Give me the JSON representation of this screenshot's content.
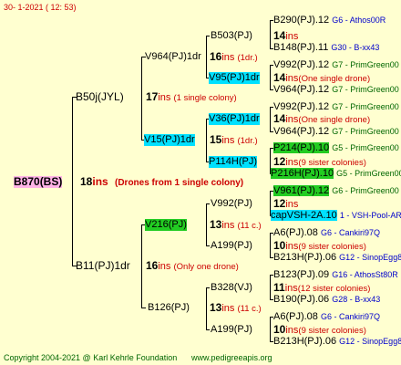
{
  "header": {
    "date": "30-   1-2021 (  12:  53)"
  },
  "root": {
    "name": "B870(BS)",
    "count": "18",
    "ins_label": "ins",
    "note": "(Drones from 1 single colony)"
  },
  "sire": {
    "name": "B50j(JYL)",
    "count": "17",
    "ins_label": "ins",
    "note": "(1 single colony)"
  },
  "dam": {
    "name": "B11(PJ)1dr",
    "count": "16",
    "ins_label": "ins",
    "note": "(Only one drone)"
  },
  "l2": [
    {
      "name": "V964(PJ)1dr",
      "count": "16",
      "ins_label": "ins",
      "note": "(1dr.)"
    },
    {
      "name": "V15(PJ)1dr",
      "count": "15",
      "ins_label": "ins",
      "note": "(1dr.)"
    },
    {
      "name": "V216(PJ)",
      "count": "13",
      "ins_label": "ins",
      "note": "(11 c.)"
    },
    {
      "name": "B126(PJ)",
      "count": "13",
      "ins_label": "ins",
      "note": "(11 c.)"
    }
  ],
  "l3": [
    {
      "name": "B503(PJ)",
      "count": "14",
      "ins_label": "ins",
      "note": ""
    },
    {
      "name": "V95(PJ)1dr",
      "count": "14",
      "ins_label": "ins",
      "note": "(One single drone)"
    },
    {
      "name": "V36(PJ)1dr",
      "count": "14",
      "ins_label": "ins",
      "note": "(One single drone)"
    },
    {
      "name": "P114H(PJ)",
      "count": "12",
      "ins_label": "ins",
      "note": "(9 sister colonies)"
    },
    {
      "name": "V992(PJ)",
      "count": "12",
      "ins_label": "ins",
      "note": ""
    },
    {
      "name": "A199(PJ)",
      "count": "10",
      "ins_label": "ins",
      "note": "(9 sister colonies)"
    },
    {
      "name": "B328(VJ)",
      "count": "11",
      "ins_label": "ins",
      "note": "(12 sister colonies)"
    },
    {
      "name": "A199(PJ)",
      "count": "10",
      "ins_label": "ins",
      "note": "(9 sister colonies)"
    }
  ],
  "l4": [
    {
      "name": "B290(PJ).12",
      "breeder": "G6 - Athos00R"
    },
    {
      "name": "B148(PJ).11",
      "breeder": "G30 - B-xx43"
    },
    {
      "name": "V992(PJ).12",
      "breeder": "G7 - PrimGreen00"
    },
    {
      "name": "V964(PJ).12",
      "breeder": "G7 - PrimGreen00"
    },
    {
      "name": "V992(PJ).12",
      "breeder": "G7 - PrimGreen00"
    },
    {
      "name": "V964(PJ).12",
      "breeder": "G7 - PrimGreen00"
    },
    {
      "name": "P214(PJ).10",
      "breeder": "G5 - PrimGreen00"
    },
    {
      "name": "P216H(PJ).10",
      "breeder": "G5 - PrimGreen00"
    },
    {
      "name": "V961(PJ).12",
      "breeder": "G6 - PrimGreen00"
    },
    {
      "name": "capVSH-2A.10",
      "breeder": "1 - VSH-Pool-AR"
    },
    {
      "name": "A6(PJ).08",
      "breeder": "G6 - Cankiri97Q"
    },
    {
      "name": "B213H(PJ).06",
      "breeder": "G12 - SinopEgg86R"
    },
    {
      "name": "B123(PJ).09",
      "breeder": "G16 - AthosSt80R"
    },
    {
      "name": "B190(PJ).06",
      "breeder": "G28 - B-xx43"
    },
    {
      "name": "A6(PJ).08",
      "breeder": "G6 - Cankiri97Q"
    },
    {
      "name": "B213H(PJ).06",
      "breeder": "G12 - SinopEgg86R"
    }
  ],
  "l4ins": [
    {
      "count": "",
      "ins_label": ""
    }
  ],
  "footer": {
    "copyright": "Copyright 2004-2021 @ Karl Kehrle Foundation",
    "url": "www.pedigreeapis.org"
  }
}
